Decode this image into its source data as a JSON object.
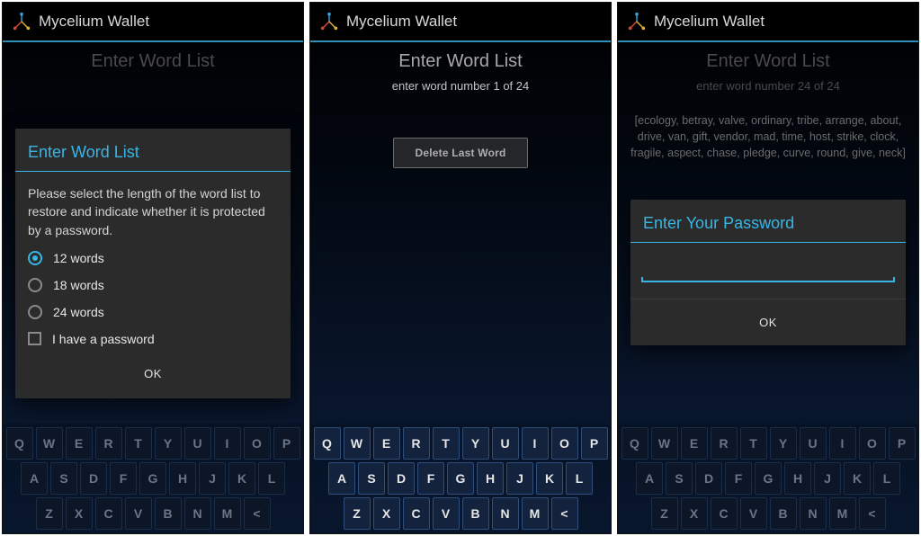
{
  "app_title": "Mycelium Wallet",
  "page_title": "Enter Word List",
  "screens": {
    "a": {
      "dialog_title": "Enter Word List",
      "instruction": "Please select the length of the word list to restore and indicate whether it is protected by a password.",
      "options": {
        "opt12": "12 words",
        "opt18": "18 words",
        "opt24": "24 words"
      },
      "checkbox_label": "I have a password",
      "ok": "OK"
    },
    "b": {
      "subtitle": "enter word number 1 of 24",
      "delete_label": "Delete Last Word"
    },
    "c": {
      "subtitle": "enter word number 24 of 24",
      "words": "[ecology, betray, valve, ordinary, tribe, arrange, about, drive, van, gift, vendor, mad, time, host, strike, clock, fragile, aspect, chase, pledge, curve, round, give, neck]",
      "dialog_title": "Enter Your Password",
      "ok": "OK"
    }
  },
  "keyboard": {
    "row1": [
      "Q",
      "W",
      "E",
      "R",
      "T",
      "Y",
      "U",
      "I",
      "O",
      "P"
    ],
    "row2": [
      "A",
      "S",
      "D",
      "F",
      "G",
      "H",
      "J",
      "K",
      "L"
    ],
    "row3": [
      "Z",
      "X",
      "C",
      "V",
      "B",
      "N",
      "M",
      "<"
    ]
  }
}
